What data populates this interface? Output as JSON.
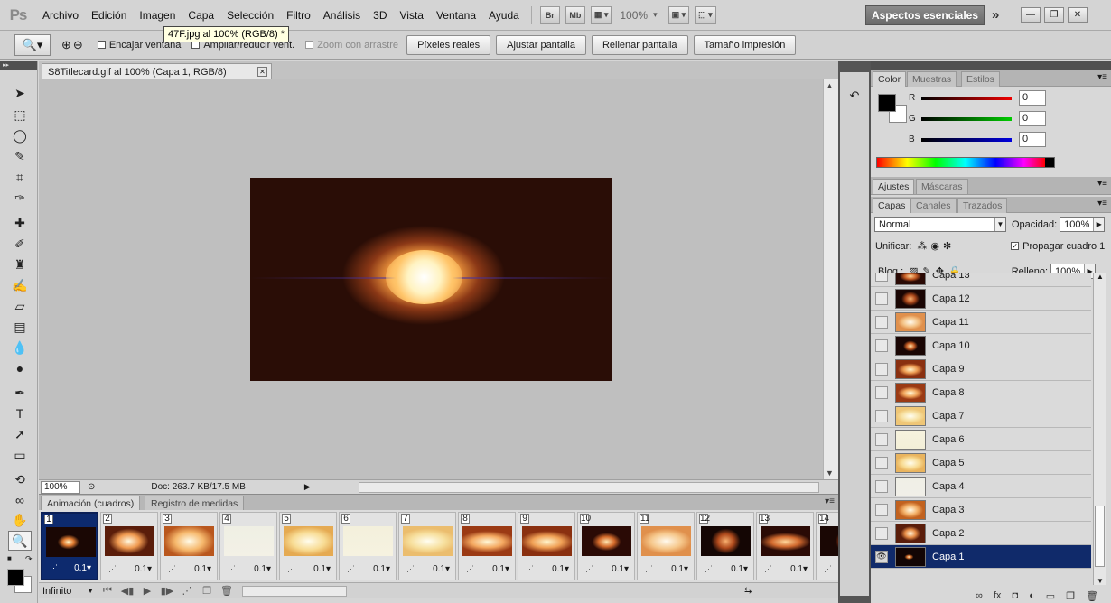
{
  "menubar": {
    "logo": "Ps",
    "items": [
      "Archivo",
      "Edición",
      "Imagen",
      "Capa",
      "Selección",
      "Filtro",
      "Análisis",
      "3D",
      "Vista",
      "Ventana",
      "Ayuda"
    ],
    "bridge": "Br",
    "minibridge": "Mb",
    "zoom": "100%",
    "workspace": "Aspectos esenciales"
  },
  "tooltip": "47F.jpg al 100% (RGB/8) *",
  "options": {
    "fit_window": "Encajar ventana",
    "resize_windows": "Ampliar/reducir vent.",
    "scrubby_zoom": "Zoom con arrastre",
    "actual_pixels": "Píxeles reales",
    "fit_screen": "Ajustar pantalla",
    "fill_screen": "Rellenar pantalla",
    "print_size": "Tamaño impresión"
  },
  "document": {
    "tab_title": "S8Titlecard.gif al 100% (Capa 1, RGB/8)",
    "zoom_field": "100%",
    "doc_info": "Doc: 263.7 KB/17.5 MB"
  },
  "animation": {
    "tab_active": "Animación (cuadros)",
    "tab_other": "Registro de medidas",
    "loop": "Infinito",
    "frames": [
      {
        "n": "1",
        "delay": "0.1"
      },
      {
        "n": "2",
        "delay": "0.1"
      },
      {
        "n": "3",
        "delay": "0.1"
      },
      {
        "n": "4",
        "delay": "0.1"
      },
      {
        "n": "5",
        "delay": "0.1"
      },
      {
        "n": "6",
        "delay": "0.1"
      },
      {
        "n": "7",
        "delay": "0.1"
      },
      {
        "n": "8",
        "delay": "0.1"
      },
      {
        "n": "9",
        "delay": "0.1"
      },
      {
        "n": "10",
        "delay": "0.1"
      },
      {
        "n": "11",
        "delay": "0.1"
      },
      {
        "n": "12",
        "delay": "0.1"
      },
      {
        "n": "13",
        "delay": "0.1"
      },
      {
        "n": "14",
        "delay": ""
      }
    ]
  },
  "color_panel": {
    "tabs": [
      "Color",
      "Muestras",
      "Estilos"
    ],
    "r_label": "R",
    "g_label": "G",
    "b_label": "B",
    "r": "0",
    "g": "0",
    "b": "0"
  },
  "adjust_panel": {
    "tabs": [
      "Ajustes",
      "Máscaras"
    ]
  },
  "layers_panel": {
    "tabs": [
      "Capas",
      "Canales",
      "Trazados"
    ],
    "blend_mode": "Normal",
    "opacity_label": "Opacidad:",
    "opacity": "100%",
    "unify_label": "Unificar:",
    "propagate": "Propagar cuadro 1",
    "lock_label": "Bloq.:",
    "fill_label": "Relleno:",
    "fill": "100%",
    "layers": [
      "Capa 13",
      "Capa 12",
      "Capa 11",
      "Capa 10",
      "Capa 9",
      "Capa 8",
      "Capa 7",
      "Capa 6",
      "Capa 5",
      "Capa 4",
      "Capa 3",
      "Capa 2",
      "Capa 1"
    ]
  }
}
